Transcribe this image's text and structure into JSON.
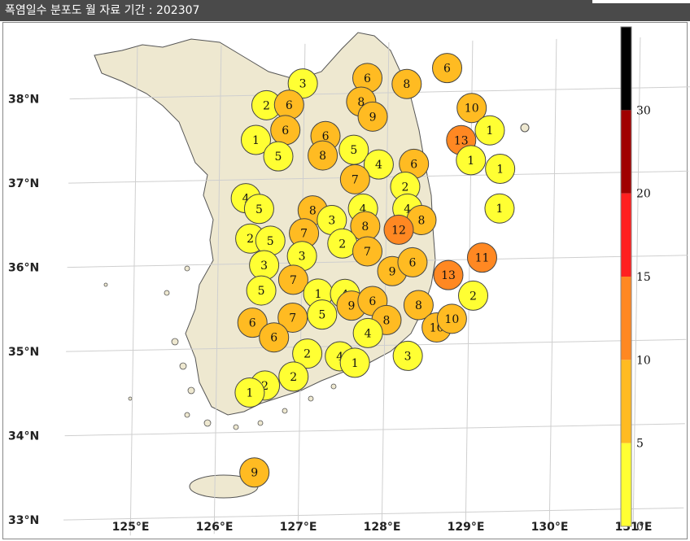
{
  "title": "폭염일수 분포도 월 자료 기간 : 202307",
  "lat_labels": [
    "38°N",
    "37°N",
    "36°N",
    "35°N",
    "34°N",
    "33°N"
  ],
  "lon_labels": [
    "125°E",
    "126°E",
    "127°E",
    "128°E",
    "129°E",
    "130°E",
    "131°E"
  ],
  "colorbar": {
    "ticks": [
      "0",
      "5",
      "10",
      "15",
      "20",
      "30"
    ],
    "colors": [
      "#ffff33",
      "#ffbb22",
      "#ff8822",
      "#ff2020",
      "#a00000",
      "#000000"
    ]
  },
  "stations": [
    {
      "v": "3",
      "lon": 126.98,
      "lat": 38.13,
      "c": "#ffff33"
    },
    {
      "v": "6",
      "lon": 127.75,
      "lat": 38.18,
      "c": "#ffbb22"
    },
    {
      "v": "8",
      "lon": 128.22,
      "lat": 38.1,
      "c": "#ffbb22"
    },
    {
      "v": "6",
      "lon": 128.7,
      "lat": 38.28,
      "c": "#ffbb22"
    },
    {
      "v": "2",
      "lon": 126.55,
      "lat": 37.88,
      "c": "#ffff33"
    },
    {
      "v": "6",
      "lon": 126.82,
      "lat": 37.88,
      "c": "#ffbb22"
    },
    {
      "v": "8",
      "lon": 127.68,
      "lat": 37.9,
      "c": "#ffbb22"
    },
    {
      "v": "10",
      "lon": 129.0,
      "lat": 37.8,
      "c": "#ffbb22"
    },
    {
      "v": "9",
      "lon": 127.82,
      "lat": 37.72,
      "c": "#ffbb22"
    },
    {
      "v": "6",
      "lon": 126.78,
      "lat": 37.58,
      "c": "#ffbb22"
    },
    {
      "v": "6",
      "lon": 127.26,
      "lat": 37.5,
      "c": "#ffbb22"
    },
    {
      "v": "1",
      "lon": 126.43,
      "lat": 37.47,
      "c": "#ffff33"
    },
    {
      "v": "1",
      "lon": 129.22,
      "lat": 37.53,
      "c": "#ffff33"
    },
    {
      "v": "13",
      "lon": 128.88,
      "lat": 37.42,
      "c": "#ff8822"
    },
    {
      "v": "5",
      "lon": 126.7,
      "lat": 37.27,
      "c": "#ffff33"
    },
    {
      "v": "8",
      "lon": 127.23,
      "lat": 37.27,
      "c": "#ffbb22"
    },
    {
      "v": "5",
      "lon": 127.6,
      "lat": 37.33,
      "c": "#ffff33"
    },
    {
      "v": "6",
      "lon": 128.32,
      "lat": 37.15,
      "c": "#ffbb22"
    },
    {
      "v": "4",
      "lon": 127.9,
      "lat": 37.15,
      "c": "#ffff33"
    },
    {
      "v": "1",
      "lon": 129.0,
      "lat": 37.18,
      "c": "#ffff33"
    },
    {
      "v": "1",
      "lon": 129.35,
      "lat": 37.07,
      "c": "#ffff33"
    },
    {
      "v": "7",
      "lon": 127.62,
      "lat": 36.98,
      "c": "#ffbb22"
    },
    {
      "v": "2",
      "lon": 128.22,
      "lat": 36.88,
      "c": "#ffff33"
    },
    {
      "v": "4",
      "lon": 126.32,
      "lat": 36.78,
      "c": "#ffff33"
    },
    {
      "v": "5",
      "lon": 126.48,
      "lat": 36.65,
      "c": "#ffff33"
    },
    {
      "v": "8",
      "lon": 127.12,
      "lat": 36.62,
      "c": "#ffbb22"
    },
    {
      "v": "4",
      "lon": 127.72,
      "lat": 36.63,
      "c": "#ffff33"
    },
    {
      "v": "4",
      "lon": 128.25,
      "lat": 36.62,
      "c": "#ffff33"
    },
    {
      "v": "1",
      "lon": 129.35,
      "lat": 36.6,
      "c": "#ffff33"
    },
    {
      "v": "3",
      "lon": 127.35,
      "lat": 36.5,
      "c": "#ffff33"
    },
    {
      "v": "8",
      "lon": 127.75,
      "lat": 36.42,
      "c": "#ffbb22"
    },
    {
      "v": "8",
      "lon": 128.42,
      "lat": 36.48,
      "c": "#ffbb22"
    },
    {
      "v": "7",
      "lon": 127.02,
      "lat": 36.35,
      "c": "#ffbb22"
    },
    {
      "v": "12",
      "lon": 128.15,
      "lat": 36.37,
      "c": "#ff8822"
    },
    {
      "v": "2",
      "lon": 126.38,
      "lat": 36.3,
      "c": "#ffff33"
    },
    {
      "v": "5",
      "lon": 126.62,
      "lat": 36.27,
      "c": "#ffff33"
    },
    {
      "v": "2",
      "lon": 127.48,
      "lat": 36.22,
      "c": "#ffff33"
    },
    {
      "v": "7",
      "lon": 127.78,
      "lat": 36.12,
      "c": "#ffbb22"
    },
    {
      "v": "3",
      "lon": 127.0,
      "lat": 36.08,
      "c": "#ffff33"
    },
    {
      "v": "11",
      "lon": 129.15,
      "lat": 36.02,
      "c": "#ff8822"
    },
    {
      "v": "3",
      "lon": 126.55,
      "lat": 35.98,
      "c": "#ffff33"
    },
    {
      "v": "9",
      "lon": 128.08,
      "lat": 35.88,
      "c": "#ffbb22"
    },
    {
      "v": "6",
      "lon": 128.32,
      "lat": 35.98,
      "c": "#ffbb22"
    },
    {
      "v": "13",
      "lon": 128.75,
      "lat": 35.82,
      "c": "#ff8822"
    },
    {
      "v": "7",
      "lon": 126.9,
      "lat": 35.8,
      "c": "#ffbb22"
    },
    {
      "v": "5",
      "lon": 126.52,
      "lat": 35.68,
      "c": "#ffff33"
    },
    {
      "v": "1",
      "lon": 127.2,
      "lat": 35.63,
      "c": "#ffff33"
    },
    {
      "v": "4",
      "lon": 127.52,
      "lat": 35.62,
      "c": "#ffff33"
    },
    {
      "v": "2",
      "lon": 129.05,
      "lat": 35.57,
      "c": "#ffff33"
    },
    {
      "v": "9",
      "lon": 127.6,
      "lat": 35.48,
      "c": "#ffbb22"
    },
    {
      "v": "6",
      "lon": 127.85,
      "lat": 35.53,
      "c": "#ffbb22"
    },
    {
      "v": "8",
      "lon": 128.4,
      "lat": 35.47,
      "c": "#ffbb22"
    },
    {
      "v": "5",
      "lon": 127.25,
      "lat": 35.38,
      "c": "#ffff33"
    },
    {
      "v": "7",
      "lon": 126.9,
      "lat": 35.35,
      "c": "#ffbb22"
    },
    {
      "v": "6",
      "lon": 126.42,
      "lat": 35.3,
      "c": "#ffbb22"
    },
    {
      "v": "8",
      "lon": 128.02,
      "lat": 35.3,
      "c": "#ffbb22"
    },
    {
      "v": "10",
      "lon": 128.62,
      "lat": 35.2,
      "c": "#ffbb22"
    },
    {
      "v": "10",
      "lon": 128.8,
      "lat": 35.3,
      "c": "#ffbb22"
    },
    {
      "v": "6",
      "lon": 126.68,
      "lat": 35.12,
      "c": "#ffbb22"
    },
    {
      "v": "4",
      "lon": 127.8,
      "lat": 35.15,
      "c": "#ffff33"
    },
    {
      "v": "2",
      "lon": 127.08,
      "lat": 34.92,
      "c": "#ffff33"
    },
    {
      "v": "4",
      "lon": 127.47,
      "lat": 34.88,
      "c": "#ffff33"
    },
    {
      "v": "1",
      "lon": 127.65,
      "lat": 34.8,
      "c": "#ffff33"
    },
    {
      "v": "3",
      "lon": 128.28,
      "lat": 34.87,
      "c": "#ffff33"
    },
    {
      "v": "2",
      "lon": 126.92,
      "lat": 34.65,
      "c": "#ffff33"
    },
    {
      "v": "2",
      "lon": 126.58,
      "lat": 34.55,
      "c": "#ffff33"
    },
    {
      "v": "1",
      "lon": 126.4,
      "lat": 34.47,
      "c": "#ffff33"
    },
    {
      "v": "9",
      "lon": 126.47,
      "lat": 33.52,
      "c": "#ffbb22"
    }
  ]
}
